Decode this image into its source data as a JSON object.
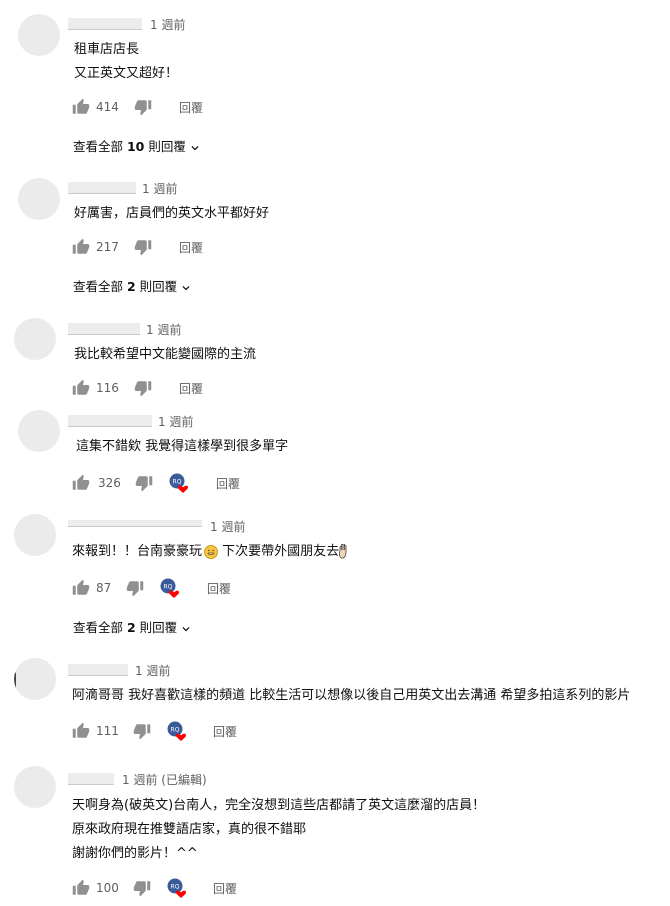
{
  "comments": [
    {
      "time": "1 週前",
      "lines": [
        "租車店店長",
        "又正英文又超好！"
      ],
      "likes": "414",
      "reply_label": "回覆",
      "view_replies": {
        "prefix": "查看全部 ",
        "count": "10",
        "suffix": " 則回覆"
      }
    },
    {
      "time": "1 週前",
      "lines": [
        "好厲害，店員們的英文水平都好好"
      ],
      "likes": "217",
      "reply_label": "回覆",
      "view_replies": {
        "prefix": "查看全部 ",
        "count": "2",
        "suffix": " 則回覆"
      }
    },
    {
      "time": "1 週前",
      "lines": [
        "我比較希望中文能變國際的主流"
      ],
      "likes": "116",
      "reply_label": "回覆"
    },
    {
      "time": "1 週前",
      "lines": [
        "這集不錯欸 我覺得這樣學到很多單字"
      ],
      "likes": "326",
      "reply_label": "回覆",
      "creator_heart": true
    },
    {
      "time": "1 週前",
      "lines_parts": [
        "來報到！！台南豪豪玩",
        " 下次要帶外國朋友去"
      ],
      "likes": "87",
      "reply_label": "回覆",
      "creator_heart": true,
      "view_replies": {
        "prefix": "查看全部 ",
        "count": "2",
        "suffix": " 則回覆"
      }
    },
    {
      "time": "1 週前",
      "lines": [
        "阿滴哥哥 我好喜歡這樣的頻道 比較生活可以想像以後自己用英文出去溝通 希望多拍這系列的影片"
      ],
      "likes": "111",
      "reply_label": "回覆",
      "creator_heart": true
    },
    {
      "time": "1 週前 (已編輯)",
      "lines": [
        "天啊身為(破英文)台南人，完全沒想到這些店都請了英文這麼溜的店員！",
        "原來政府現在推雙語店家，真的很不錯耶",
        "謝謝你們的影片！^^"
      ],
      "likes": "100",
      "reply_label": "回覆",
      "creator_heart": true
    }
  ],
  "icons": {
    "like": "thumbs-up-icon",
    "dislike": "thumbs-down-icon",
    "creator_heart": "creator-heart-icon",
    "chevron": "chevron-down-icon",
    "emoji_grin": "grinning-face-emoji",
    "emoji_hand": "raised-hand-emoji"
  },
  "colors": {
    "heart": "#ff0000",
    "avatar_placeholder": "#ebebeb",
    "meta_text": "#606060"
  }
}
